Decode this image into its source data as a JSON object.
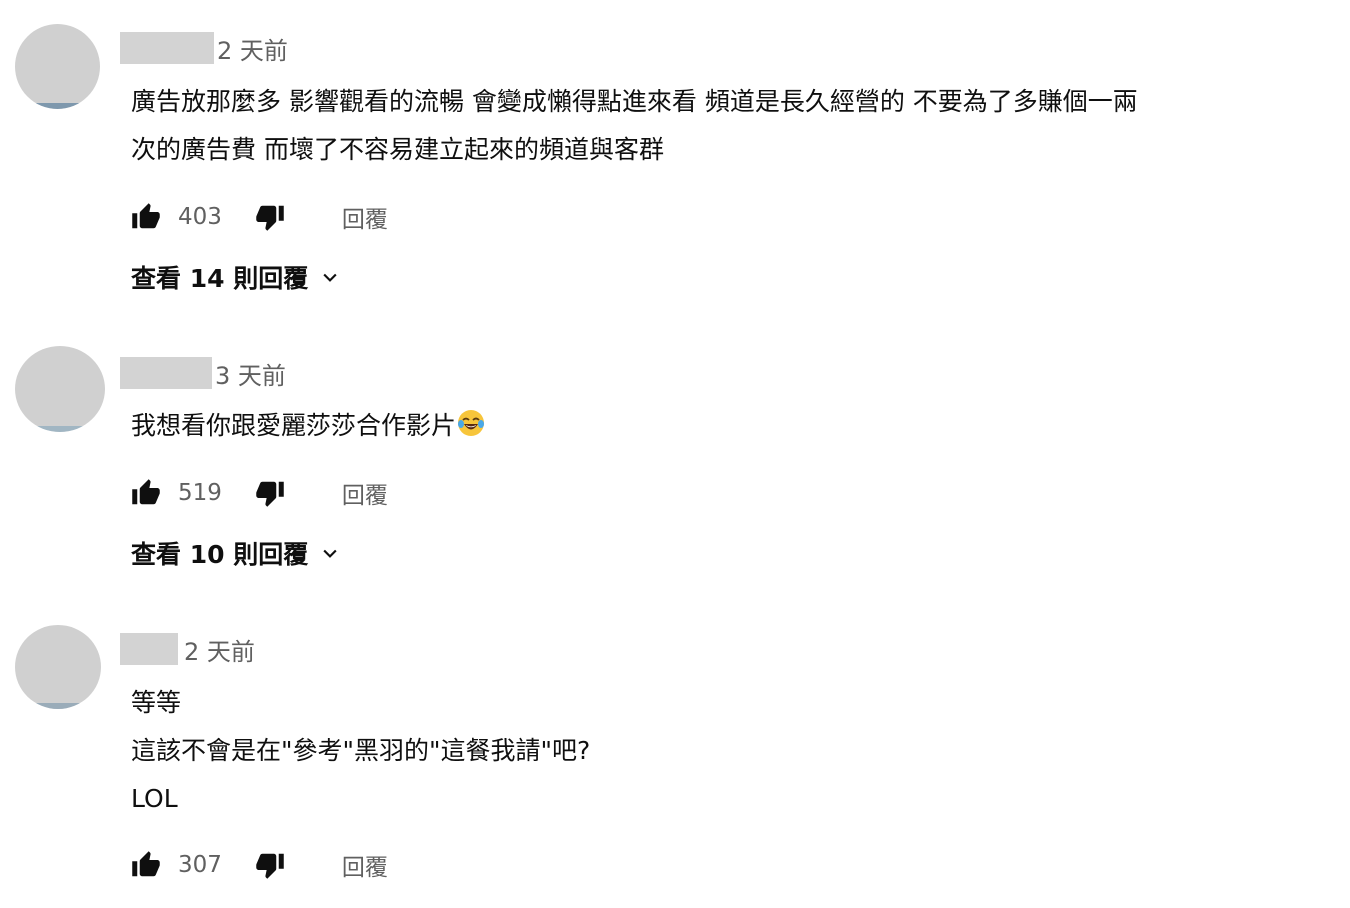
{
  "comments": [
    {
      "time": "2 天前",
      "lines": [
        "廣告放那麼多  影響觀看的流暢 會變成懶得點進來看  頻道是長久經營的  不要為了多賺個一兩",
        "次的廣告費  而壞了不容易建立起來的頻道與客群"
      ],
      "likes": "403",
      "reply_label": "回覆",
      "view_replies": "查看 14 則回覆"
    },
    {
      "time": "3 天前",
      "lines": [
        "我想看你跟愛麗莎莎合作影片"
      ],
      "emoji": "face-with-tears-of-joy",
      "likes": "519",
      "reply_label": "回覆",
      "view_replies": "查看 10 則回覆"
    },
    {
      "time": "2 天前",
      "lines": [
        "等等",
        "這該不會是在\"參考\"黑羽的\"這餐我請\"吧?",
        "LOL"
      ],
      "likes": "307",
      "reply_label": "回覆"
    }
  ],
  "colors": {
    "text_primary": "#0f0f0f",
    "text_secondary": "#606060",
    "avatar_placeholder": "#d0d0d0",
    "author_blur": "#d3d3d3"
  },
  "icons": [
    "thumbs-up-icon",
    "thumbs-down-icon",
    "chevron-down-icon",
    "face-with-tears-of-joy-emoji"
  ]
}
